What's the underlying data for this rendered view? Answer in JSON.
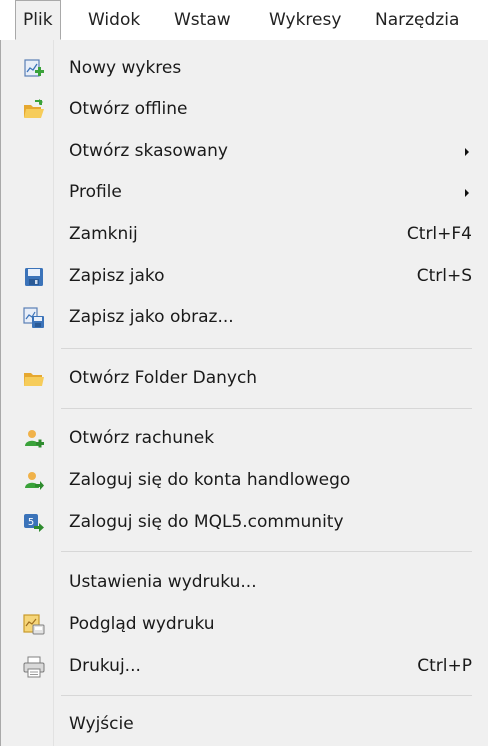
{
  "menubar": {
    "items": [
      "Plik",
      "Widok",
      "Wstaw",
      "Wykresy",
      "Narzędzia"
    ]
  },
  "menu": {
    "items": [
      {
        "label": "Nowy wykres",
        "icon": "new-chart-icon",
        "shortcut": "",
        "submenu": false
      },
      {
        "label": "Otwórz offline",
        "icon": "open-folder-icon",
        "shortcut": "",
        "submenu": false
      },
      {
        "label": "Otwórz skasowany",
        "icon": "",
        "shortcut": "",
        "submenu": true
      },
      {
        "label": "Profile",
        "icon": "",
        "shortcut": "",
        "submenu": true
      },
      {
        "label": "Zamknij",
        "icon": "",
        "shortcut": "Ctrl+F4",
        "submenu": false
      },
      {
        "label": "Zapisz jako",
        "icon": "floppy-disk-icon",
        "shortcut": "Ctrl+S",
        "submenu": false
      },
      {
        "label": "Zapisz jako obraz...",
        "icon": "save-image-icon",
        "shortcut": "",
        "submenu": false
      },
      {
        "label": "Otwórz Folder Danych",
        "icon": "folder-icon",
        "shortcut": "",
        "submenu": false
      },
      {
        "label": "Otwórz rachunek",
        "icon": "add-account-icon",
        "shortcut": "",
        "submenu": false
      },
      {
        "label": "Zaloguj się do konta handlowego",
        "icon": "login-user-icon",
        "shortcut": "",
        "submenu": false
      },
      {
        "label": "Zaloguj się do MQL5.community",
        "icon": "mql5-login-icon",
        "shortcut": "",
        "submenu": false
      },
      {
        "label": "Ustawienia wydruku...",
        "icon": "",
        "shortcut": "",
        "submenu": false
      },
      {
        "label": "Podgląd wydruku",
        "icon": "print-preview-icon",
        "shortcut": "",
        "submenu": false
      },
      {
        "label": "Drukuj...",
        "icon": "printer-icon",
        "shortcut": "Ctrl+P",
        "submenu": false
      },
      {
        "label": "Wyjście",
        "icon": "",
        "shortcut": "",
        "submenu": false
      }
    ]
  },
  "colors": {
    "menu_bg": "#f0f0f0",
    "separator": "#d7d7d7",
    "icon_green": "#3aa23a",
    "icon_folder": "#f2c14e",
    "icon_blue": "#3b73b9"
  }
}
